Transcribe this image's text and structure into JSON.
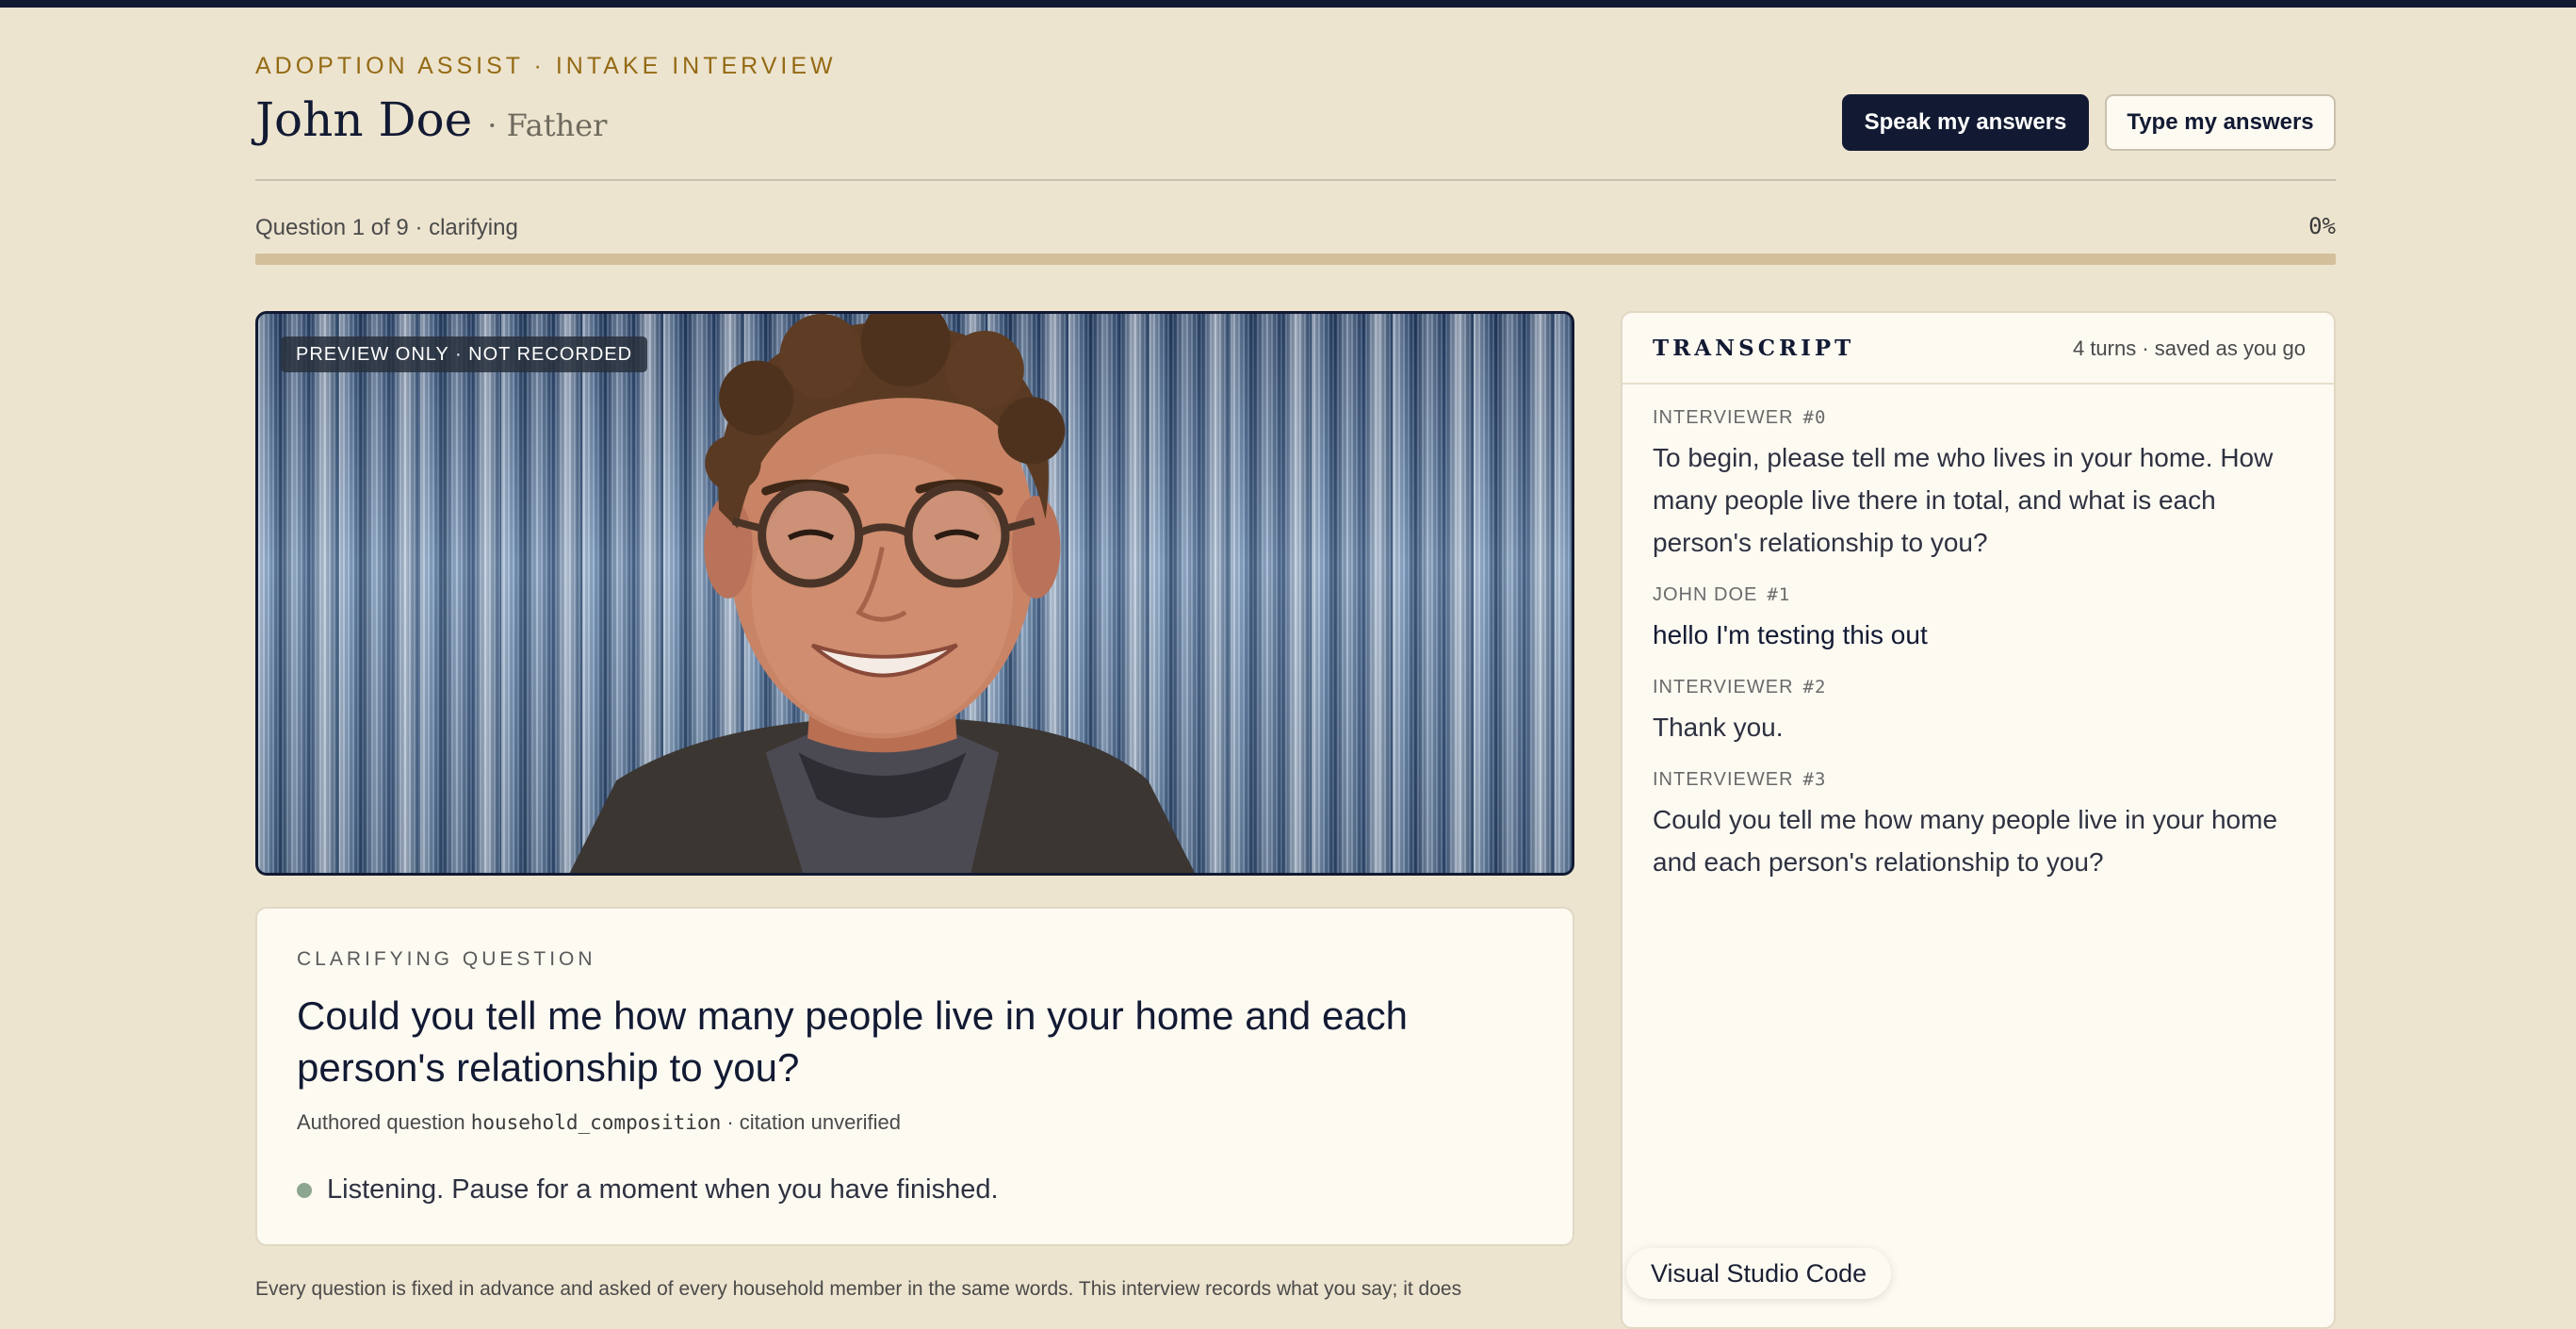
{
  "header": {
    "eyebrow": "ADOPTION ASSIST · INTAKE INTERVIEW",
    "name": "John Doe",
    "role": "· Father",
    "speak_button": "Speak my answers",
    "type_button": "Type my answers"
  },
  "progress": {
    "label": "Question 1 of 9 · clarifying",
    "percent_label": "0%",
    "percent": 0
  },
  "video": {
    "tag": "PREVIEW ONLY · NOT RECORDED"
  },
  "question_card": {
    "eyebrow": "CLARIFYING QUESTION",
    "question": "Could you tell me how many people live in your home and each person's relationship to you?",
    "meta_prefix": "Authored question",
    "meta_code": "household_composition",
    "meta_suffix": "· citation unverified",
    "status": "Listening. Pause for a moment when you have finished."
  },
  "footnote": "Every question is fixed in advance and asked of every household member in the same words. This interview records what you say; it does",
  "transcript": {
    "title": "TRANSCRIPT",
    "meta": "4 turns · saved as you go",
    "turns": [
      {
        "speaker": "INTERVIEWER",
        "num": "#0",
        "text": "To begin, please tell me who lives in your home. How many people live there in total, and what is each person's relationship to you?"
      },
      {
        "speaker": "JOHN DOE",
        "num": "#1",
        "text": "hello I'm testing this out"
      },
      {
        "speaker": "INTERVIEWER",
        "num": "#2",
        "text": "Thank you."
      },
      {
        "speaker": "INTERVIEWER",
        "num": "#3",
        "text": "Could you tell me how many people live in your home and each person's relationship to you?"
      }
    ]
  },
  "tooltip": "Visual Studio Code",
  "colors": {
    "background": "#ede4cf",
    "accent": "#946a14",
    "navy": "#121a33",
    "progress_track": "#d3bf9a",
    "listening_dot": "#8ca58f"
  }
}
